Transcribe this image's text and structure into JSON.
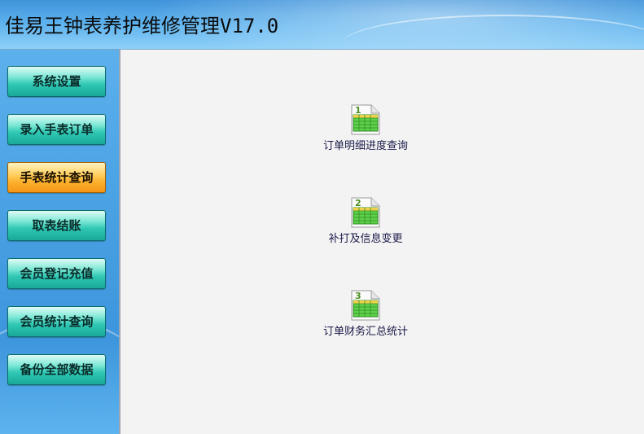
{
  "app": {
    "title": "佳易王钟表养护维修管理V17.0"
  },
  "sidebar": {
    "items": [
      {
        "label": "系统设置",
        "active": false
      },
      {
        "label": "录入手表订单",
        "active": false
      },
      {
        "label": "手表统计查询",
        "active": true
      },
      {
        "label": "取表结账",
        "active": false
      },
      {
        "label": "会员登记充值",
        "active": false
      },
      {
        "label": "会员统计查询",
        "active": false
      },
      {
        "label": "备份全部数据",
        "active": false
      }
    ]
  },
  "main": {
    "functions": [
      {
        "number": "1",
        "label": "订单明细进度查询",
        "icon": "numbered-spreadsheet-icon"
      },
      {
        "number": "2",
        "label": "补打及信息变更",
        "icon": "numbered-spreadsheet-icon"
      },
      {
        "number": "3",
        "label": "订单财务汇总统计",
        "icon": "numbered-spreadsheet-icon"
      }
    ]
  },
  "colors": {
    "nav_button": "#2fc7b3",
    "nav_button_active": "#fdb02d",
    "header": "#5fb3ee",
    "sidebar": "#4aa2e4",
    "content_bg": "#f3f3f3"
  }
}
